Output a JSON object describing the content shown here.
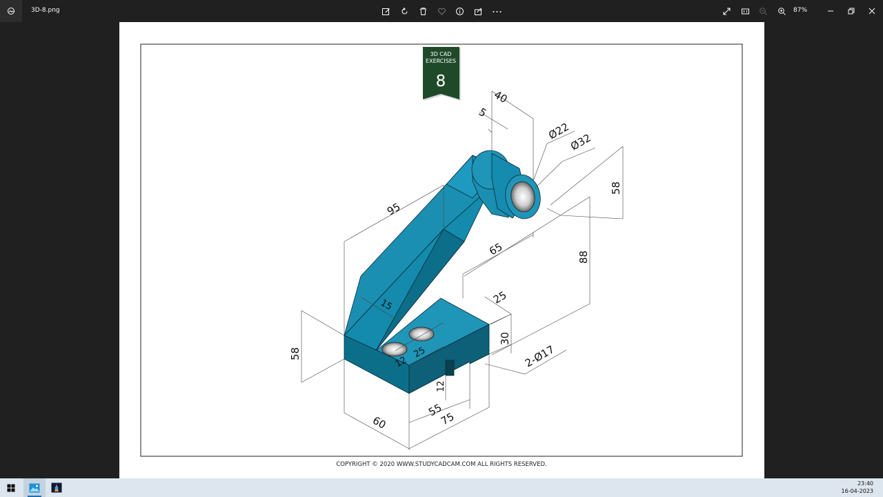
{
  "window": {
    "file_name": "3D-8.png",
    "zoom_level": "87%"
  },
  "toolbar": {
    "icons": [
      "edit-icon",
      "rotate-icon",
      "delete-icon",
      "favorite-icon",
      "info-icon",
      "share-icon",
      "more-icon"
    ],
    "right_icons": [
      "fullscreen-icon",
      "fit-icon",
      "zoom-out-icon",
      "zoom-in-icon"
    ]
  },
  "drawing": {
    "badge_title": "3D CAD EXERCISES",
    "badge_number": "8",
    "copyright": "COPYRIGHT © 2020 WWW.STUDYCADCAM.COM ALL RIGHTS RESERVED.",
    "dimensions": {
      "d40": "40",
      "d5": "5",
      "d22": "Ø22",
      "d32": "Ø32",
      "d95": "95",
      "d65": "65",
      "d58_right": "58",
      "d88": "88",
      "d15": "15",
      "d25_top": "25",
      "d30": "30",
      "d2phi17": "2-Ø17",
      "d58_left": "58",
      "d12_a": "12",
      "d25_mid": "25",
      "d12_b": "12",
      "d55": "55",
      "d60": "60",
      "d75": "75"
    },
    "colors": {
      "body_top": "#1f95b8",
      "body_front": "#0c6f8a",
      "body_side": "#0e5f78",
      "badge": "#1f4a2a"
    }
  },
  "taskbar": {
    "time": "23:40",
    "date": "16-04-2023"
  }
}
